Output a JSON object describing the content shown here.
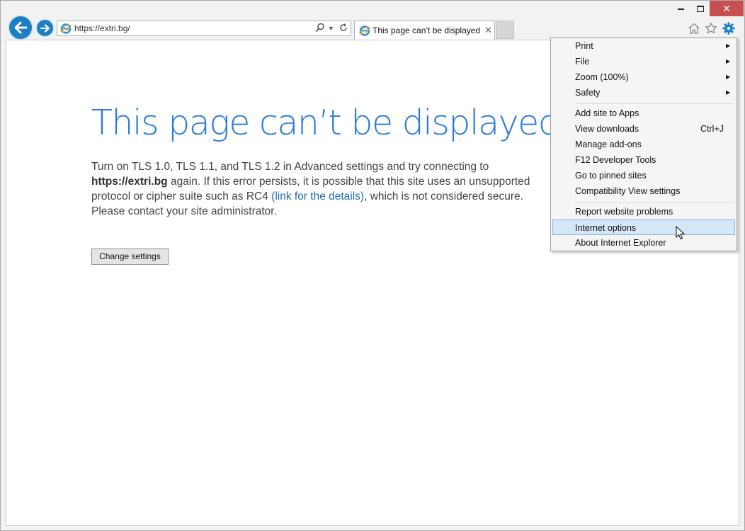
{
  "window": {
    "minimize_icon": "minimize-icon",
    "maximize_icon": "maximize-icon",
    "close_glyph": "✕"
  },
  "nav": {
    "back_icon": "back-arrow-icon",
    "forward_icon": "forward-arrow-icon"
  },
  "address_bar": {
    "url": "https://extri.bg/",
    "search_icon": "search-icon",
    "refresh_icon": "refresh-icon"
  },
  "tab": {
    "title": "This page can’t be displayed",
    "close_glyph": "✕"
  },
  "page": {
    "heading": "This page can’t be displayed",
    "body_part1": "Turn on TLS 1.0, TLS 1.1, and TLS 1.2 in Advanced settings and try connecting to ",
    "body_url": "https://extri.bg",
    "body_part2": " again. If this error persists, it is possible that this site uses an unsupported protocol or cipher suite such as RC4 ",
    "body_link": "(link for the details)",
    "body_part3": ", which is not considered secure. Please contact your site administrator.",
    "button_label": "Change settings"
  },
  "menu": {
    "items": [
      {
        "label": "Print",
        "submenu": true
      },
      {
        "label": "File",
        "submenu": true
      },
      {
        "label": "Zoom (100%)",
        "submenu": true
      },
      {
        "label": "Safety",
        "submenu": true
      },
      {
        "label": "Add site to Apps"
      },
      {
        "label": "View downloads",
        "shortcut": "Ctrl+J"
      },
      {
        "label": "Manage add-ons"
      },
      {
        "label": "F12 Developer Tools"
      },
      {
        "label": "Go to pinned sites"
      },
      {
        "label": "Compatibility View settings"
      },
      {
        "label": "Report website problems"
      },
      {
        "label": "Internet options",
        "highlighted": true
      },
      {
        "label": "About Internet Explorer"
      }
    ],
    "submenu_glyph": "▶"
  },
  "colors": {
    "accent_blue": "#2a7bde",
    "link_blue": "#1e6ab3",
    "close_red": "#c74f4f",
    "menu_highlight": "#d5e6f7"
  }
}
